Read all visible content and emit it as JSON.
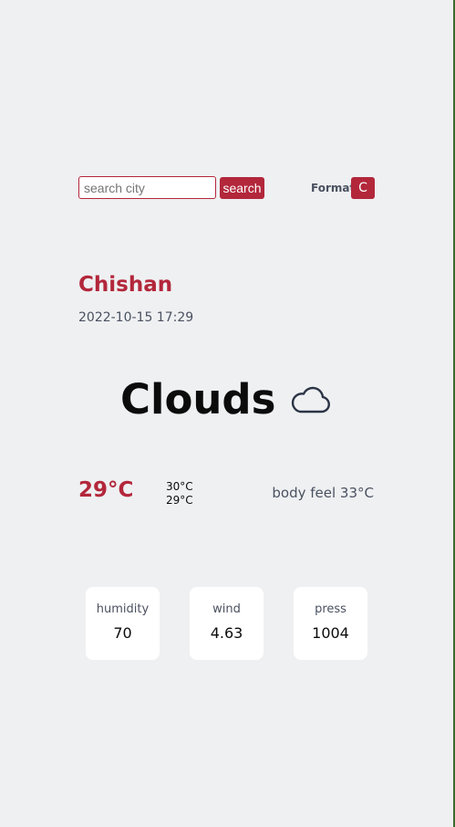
{
  "search": {
    "placeholder": "search city",
    "value": "",
    "button_label": "search"
  },
  "format": {
    "label": "Format",
    "unit_button": "C"
  },
  "location": {
    "city": "Chishan",
    "datetime": "2022-10-15 17:29"
  },
  "weather": {
    "condition": "Clouds",
    "icon": "cloud-icon"
  },
  "temperature": {
    "current": "29°C",
    "max": "30°C",
    "min": "29°C",
    "body_feel": "body feel 33°C"
  },
  "stats": [
    {
      "label": "humidity",
      "value": "70"
    },
    {
      "label": "wind",
      "value": "4.63"
    },
    {
      "label": "press",
      "value": "1004"
    }
  ],
  "colors": {
    "accent": "#b3273b",
    "background": "#eff0f2",
    "muted_text": "#4a5160",
    "card": "#ffffff"
  }
}
